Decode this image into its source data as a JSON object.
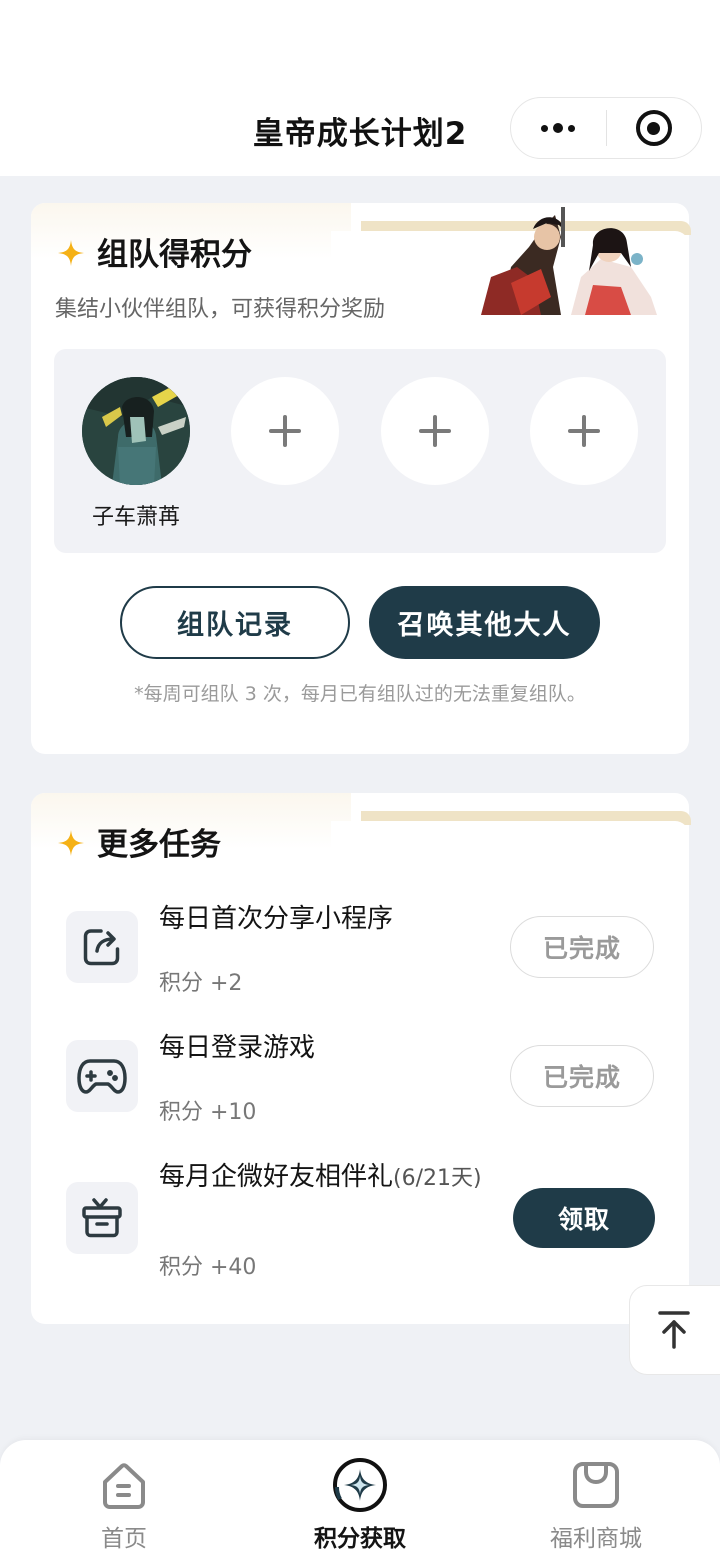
{
  "header": {
    "title": "皇帝成长计划2",
    "more_icon": "more-dots-icon",
    "close_icon": "target-circle-icon"
  },
  "team_section": {
    "title": "组队得积分",
    "subtitle": "集结小伙伴组队，可获得积分奖励",
    "member": {
      "name": "子车萧苒"
    },
    "empty_slots": 3,
    "record_button": "组队记录",
    "invite_button": "召唤其他大人",
    "note": "*每周可组队 3 次，每月已有组队过的无法重复组队。"
  },
  "tasks_section": {
    "title": "更多任务",
    "tasks": [
      {
        "title": "每日首次分享小程序",
        "title_sub": "",
        "points": "积分 +2",
        "action": "已完成",
        "icon": "share-icon"
      },
      {
        "title": "每日登录游戏",
        "title_sub": "",
        "points": "积分 +10",
        "action": "已完成",
        "icon": "gamepad-icon"
      },
      {
        "title": "每月企微好友相伴礼",
        "title_sub": "(6/21天)",
        "points": "积分 +40",
        "action": "领取",
        "icon": "gift-box-icon"
      }
    ]
  },
  "tabbar": {
    "items": [
      {
        "label": "首页",
        "icon": "home-icon"
      },
      {
        "label": "积分获取",
        "icon": "points-star-icon"
      },
      {
        "label": "福利商城",
        "icon": "shopping-bag-icon"
      }
    ],
    "active": 1
  },
  "colors": {
    "accent": "#1f3b48",
    "star": "#f5b116",
    "page_bg": "#eff1f5"
  }
}
